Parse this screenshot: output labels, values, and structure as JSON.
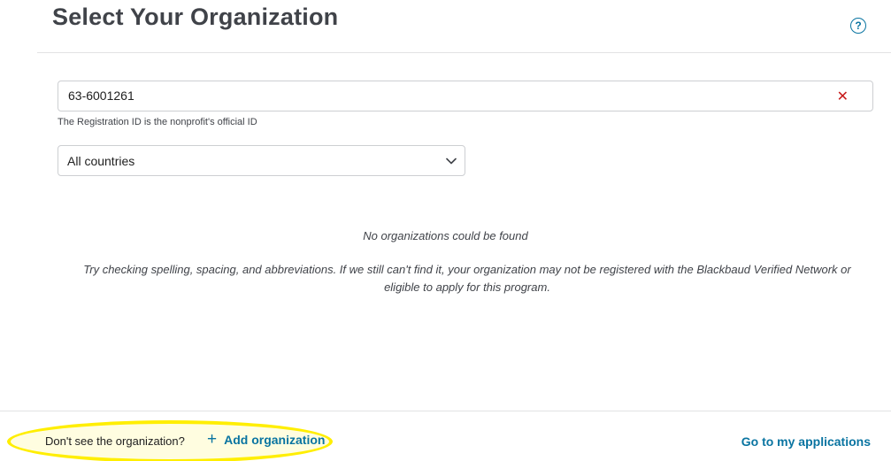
{
  "header": {
    "title": "Select Your Organization",
    "help_icon": "question-circle-icon",
    "help_glyph": "?"
  },
  "search": {
    "value": "63-6001261",
    "helper": "The Registration ID is the nonprofit's official ID",
    "clear_icon": "close-icon",
    "clear_glyph": "✕",
    "clear_color": "#c71b1b"
  },
  "country_select": {
    "selected": "All countries",
    "icon": "chevron-down-icon"
  },
  "results": {
    "empty_title": "No organizations could be found",
    "empty_description": "Try checking spelling, spacing, and abbreviations. If we still can't find it, your organization may not be registered with the Blackbaud Verified Network or eligible to apply for this program."
  },
  "footer": {
    "prompt": "Don't see the organization?",
    "add_label": "Add organization",
    "add_icon": "plus-icon",
    "add_glyph": "+",
    "go_label": "Go to my applications"
  },
  "colors": {
    "accent": "#0974a1",
    "highlight": "#ffee00",
    "title": "#404349"
  }
}
